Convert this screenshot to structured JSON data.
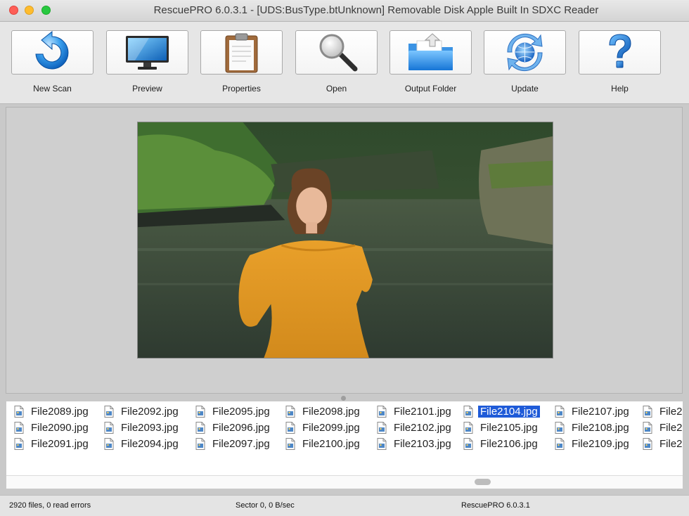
{
  "window": {
    "title": "RescuePRO 6.0.3.1 - [UDS:BusType.btUnknown] Removable Disk Apple Built In SDXC Reader"
  },
  "toolbar": {
    "buttons": [
      {
        "label": "New Scan",
        "icon": "refresh-arrow-icon"
      },
      {
        "label": "Preview",
        "icon": "monitor-icon"
      },
      {
        "label": "Properties",
        "icon": "clipboard-icon"
      },
      {
        "label": "Open",
        "icon": "magnifier-icon"
      },
      {
        "label": "Output Folder",
        "icon": "folder-icon"
      },
      {
        "label": "Update",
        "icon": "globe-sync-icon"
      },
      {
        "label": "Help",
        "icon": "question-mark-icon"
      }
    ]
  },
  "files": {
    "columns": [
      [
        "File2089.jpg",
        "File2090.jpg",
        "File2091.jpg"
      ],
      [
        "File2092.jpg",
        "File2093.jpg",
        "File2094.jpg"
      ],
      [
        "File2095.jpg",
        "File2096.jpg",
        "File2097.jpg"
      ],
      [
        "File2098.jpg",
        "File2099.jpg",
        "File2100.jpg"
      ],
      [
        "File2101.jpg",
        "File2102.jpg",
        "File2103.jpg"
      ],
      [
        "File2104.jpg",
        "File2105.jpg",
        "File2106.jpg"
      ],
      [
        "File2107.jpg",
        "File2108.jpg",
        "File2109.jpg"
      ],
      [
        "File2",
        "File2",
        "File2"
      ]
    ],
    "selected": "File2104.jpg"
  },
  "status": {
    "files": "2920 files, 0 read errors",
    "sector": "Sector 0, 0 B/sec",
    "version": "RescuePRO 6.0.3.1"
  },
  "colors": {
    "selection": "#1f5bd8"
  }
}
